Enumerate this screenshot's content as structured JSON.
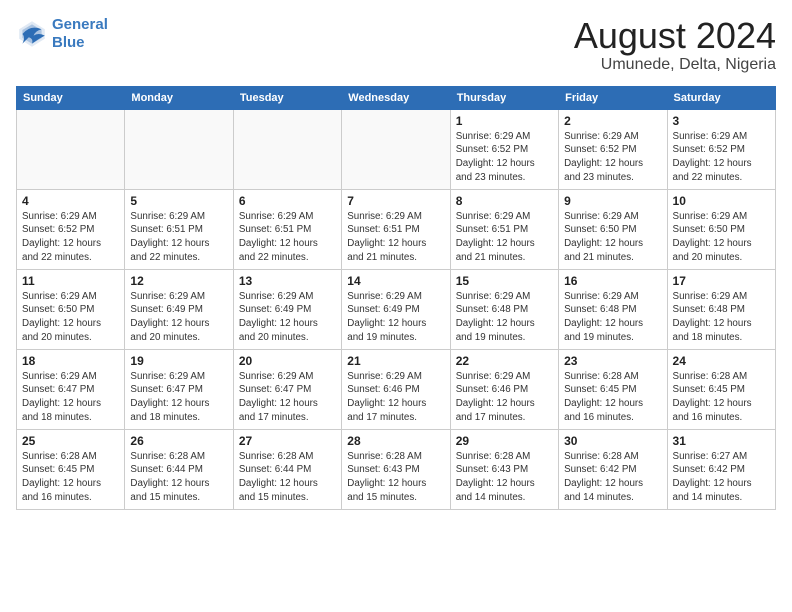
{
  "header": {
    "logo_line1": "General",
    "logo_line2": "Blue",
    "main_title": "August 2024",
    "subtitle": "Umunede, Delta, Nigeria"
  },
  "weekdays": [
    "Sunday",
    "Monday",
    "Tuesday",
    "Wednesday",
    "Thursday",
    "Friday",
    "Saturday"
  ],
  "weeks": [
    [
      {
        "day": "",
        "info": ""
      },
      {
        "day": "",
        "info": ""
      },
      {
        "day": "",
        "info": ""
      },
      {
        "day": "",
        "info": ""
      },
      {
        "day": "1",
        "info": "Sunrise: 6:29 AM\nSunset: 6:52 PM\nDaylight: 12 hours\nand 23 minutes."
      },
      {
        "day": "2",
        "info": "Sunrise: 6:29 AM\nSunset: 6:52 PM\nDaylight: 12 hours\nand 23 minutes."
      },
      {
        "day": "3",
        "info": "Sunrise: 6:29 AM\nSunset: 6:52 PM\nDaylight: 12 hours\nand 22 minutes."
      }
    ],
    [
      {
        "day": "4",
        "info": "Sunrise: 6:29 AM\nSunset: 6:52 PM\nDaylight: 12 hours\nand 22 minutes."
      },
      {
        "day": "5",
        "info": "Sunrise: 6:29 AM\nSunset: 6:51 PM\nDaylight: 12 hours\nand 22 minutes."
      },
      {
        "day": "6",
        "info": "Sunrise: 6:29 AM\nSunset: 6:51 PM\nDaylight: 12 hours\nand 22 minutes."
      },
      {
        "day": "7",
        "info": "Sunrise: 6:29 AM\nSunset: 6:51 PM\nDaylight: 12 hours\nand 21 minutes."
      },
      {
        "day": "8",
        "info": "Sunrise: 6:29 AM\nSunset: 6:51 PM\nDaylight: 12 hours\nand 21 minutes."
      },
      {
        "day": "9",
        "info": "Sunrise: 6:29 AM\nSunset: 6:50 PM\nDaylight: 12 hours\nand 21 minutes."
      },
      {
        "day": "10",
        "info": "Sunrise: 6:29 AM\nSunset: 6:50 PM\nDaylight: 12 hours\nand 20 minutes."
      }
    ],
    [
      {
        "day": "11",
        "info": "Sunrise: 6:29 AM\nSunset: 6:50 PM\nDaylight: 12 hours\nand 20 minutes."
      },
      {
        "day": "12",
        "info": "Sunrise: 6:29 AM\nSunset: 6:49 PM\nDaylight: 12 hours\nand 20 minutes."
      },
      {
        "day": "13",
        "info": "Sunrise: 6:29 AM\nSunset: 6:49 PM\nDaylight: 12 hours\nand 20 minutes."
      },
      {
        "day": "14",
        "info": "Sunrise: 6:29 AM\nSunset: 6:49 PM\nDaylight: 12 hours\nand 19 minutes."
      },
      {
        "day": "15",
        "info": "Sunrise: 6:29 AM\nSunset: 6:48 PM\nDaylight: 12 hours\nand 19 minutes."
      },
      {
        "day": "16",
        "info": "Sunrise: 6:29 AM\nSunset: 6:48 PM\nDaylight: 12 hours\nand 19 minutes."
      },
      {
        "day": "17",
        "info": "Sunrise: 6:29 AM\nSunset: 6:48 PM\nDaylight: 12 hours\nand 18 minutes."
      }
    ],
    [
      {
        "day": "18",
        "info": "Sunrise: 6:29 AM\nSunset: 6:47 PM\nDaylight: 12 hours\nand 18 minutes."
      },
      {
        "day": "19",
        "info": "Sunrise: 6:29 AM\nSunset: 6:47 PM\nDaylight: 12 hours\nand 18 minutes."
      },
      {
        "day": "20",
        "info": "Sunrise: 6:29 AM\nSunset: 6:47 PM\nDaylight: 12 hours\nand 17 minutes."
      },
      {
        "day": "21",
        "info": "Sunrise: 6:29 AM\nSunset: 6:46 PM\nDaylight: 12 hours\nand 17 minutes."
      },
      {
        "day": "22",
        "info": "Sunrise: 6:29 AM\nSunset: 6:46 PM\nDaylight: 12 hours\nand 17 minutes."
      },
      {
        "day": "23",
        "info": "Sunrise: 6:28 AM\nSunset: 6:45 PM\nDaylight: 12 hours\nand 16 minutes."
      },
      {
        "day": "24",
        "info": "Sunrise: 6:28 AM\nSunset: 6:45 PM\nDaylight: 12 hours\nand 16 minutes."
      }
    ],
    [
      {
        "day": "25",
        "info": "Sunrise: 6:28 AM\nSunset: 6:45 PM\nDaylight: 12 hours\nand 16 minutes."
      },
      {
        "day": "26",
        "info": "Sunrise: 6:28 AM\nSunset: 6:44 PM\nDaylight: 12 hours\nand 15 minutes."
      },
      {
        "day": "27",
        "info": "Sunrise: 6:28 AM\nSunset: 6:44 PM\nDaylight: 12 hours\nand 15 minutes."
      },
      {
        "day": "28",
        "info": "Sunrise: 6:28 AM\nSunset: 6:43 PM\nDaylight: 12 hours\nand 15 minutes."
      },
      {
        "day": "29",
        "info": "Sunrise: 6:28 AM\nSunset: 6:43 PM\nDaylight: 12 hours\nand 14 minutes."
      },
      {
        "day": "30",
        "info": "Sunrise: 6:28 AM\nSunset: 6:42 PM\nDaylight: 12 hours\nand 14 minutes."
      },
      {
        "day": "31",
        "info": "Sunrise: 6:27 AM\nSunset: 6:42 PM\nDaylight: 12 hours\nand 14 minutes."
      }
    ]
  ]
}
